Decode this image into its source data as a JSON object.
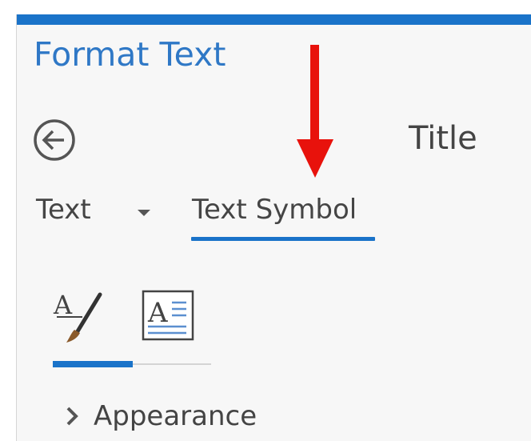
{
  "pane": {
    "title": "Format Text",
    "selection_name": "Title",
    "accent_color": "#1a73c9"
  },
  "nav": {
    "back_icon": "back-circle-arrow-icon"
  },
  "tabs": [
    {
      "label": "Text",
      "selected": false,
      "has_dropdown": true
    },
    {
      "label": "Text Symbol",
      "selected": true
    }
  ],
  "subtabs": [
    {
      "icon": "text-fill-outline-icon",
      "selected": true
    },
    {
      "icon": "text-box-icon",
      "selected": false
    }
  ],
  "sections": [
    {
      "label": "Appearance",
      "expanded": false,
      "icon": "chevron-right-icon"
    }
  ],
  "annotation": {
    "icon": "red-down-arrow-icon",
    "color": "#e8120c"
  }
}
